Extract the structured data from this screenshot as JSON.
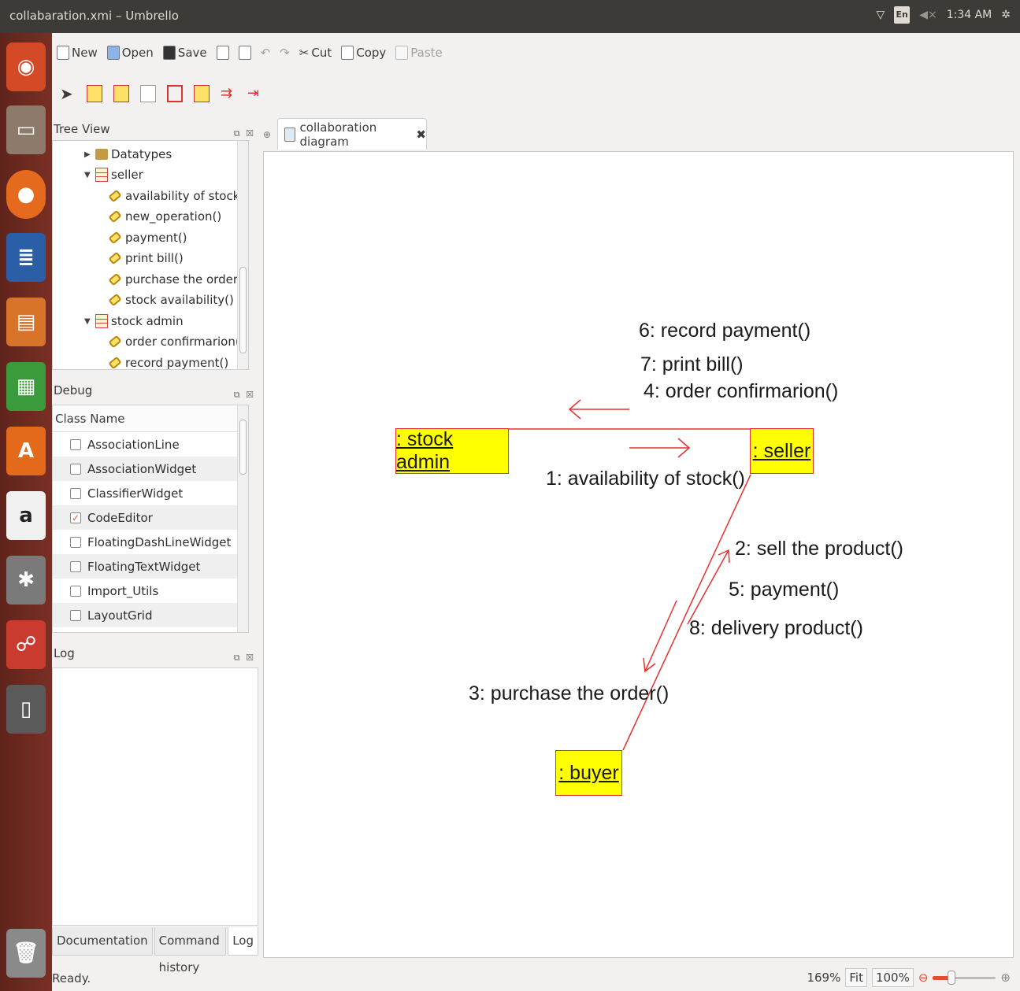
{
  "window": {
    "title": "collabaration.xmi – Umbrello"
  },
  "indicators": {
    "keyboard": "En",
    "time": "1:34 AM"
  },
  "launcher": {
    "items": [
      "ubuntu-icon",
      "files-icon",
      "firefox-icon",
      "writer-icon",
      "impress-icon",
      "calc-icon",
      "software-center-icon",
      "amazon-icon",
      "settings-icon",
      "umbrello-icon",
      "device-icon",
      "trash-icon"
    ]
  },
  "toolbar": {
    "new_label": "New",
    "open_label": "Open",
    "save_label": "Save",
    "cut_label": "Cut",
    "copy_label": "Copy",
    "paste_label": "Paste"
  },
  "tree_view": {
    "title": "Tree View",
    "items": [
      {
        "label": "Datatypes"
      },
      {
        "label": "seller"
      },
      {
        "label": "availability of stock()"
      },
      {
        "label": "new_operation()"
      },
      {
        "label": "payment()"
      },
      {
        "label": "print bill()"
      },
      {
        "label": "purchase the order()"
      },
      {
        "label": "stock availability()"
      },
      {
        "label": "stock admin"
      },
      {
        "label": "order confirmarion()"
      },
      {
        "label": "record payment()"
      }
    ]
  },
  "debug": {
    "title": "Debug",
    "column_header": "Class Name",
    "rows": [
      {
        "label": "AssociationLine",
        "checked": false
      },
      {
        "label": "AssociationWidget",
        "checked": false
      },
      {
        "label": "ClassifierWidget",
        "checked": false
      },
      {
        "label": "CodeEditor",
        "checked": true
      },
      {
        "label": "FloatingDashLineWidget",
        "checked": false
      },
      {
        "label": "FloatingTextWidget",
        "checked": false
      },
      {
        "label": "Import_Utils",
        "checked": false
      },
      {
        "label": "LayoutGrid",
        "checked": false
      }
    ]
  },
  "log": {
    "title": "Log"
  },
  "bottom_tabs": [
    "Documentation",
    "Command history",
    "Log"
  ],
  "document_tab": {
    "label": "collaboration diagram"
  },
  "diagram": {
    "objects": {
      "stock_admin": ": stock admin",
      "seller": ": seller",
      "buyer": ": buyer"
    },
    "messages": {
      "m6": "6: record payment()",
      "m7": "7: print bill()",
      "m4": "4: order confirmarion()",
      "m1": "1: availability of stock()",
      "m2": "2: sell the product()",
      "m5": "5: payment()",
      "m8": "8: delivery product()",
      "m3": "3: purchase the order()"
    },
    "line_color": "#e53030",
    "object_fill": "#ffff00"
  },
  "status": {
    "text": "Ready.",
    "zoom": "169%",
    "fit_label": "Fit",
    "hundred_label": "100%",
    "zoom_slider_fraction": 0.3
  }
}
